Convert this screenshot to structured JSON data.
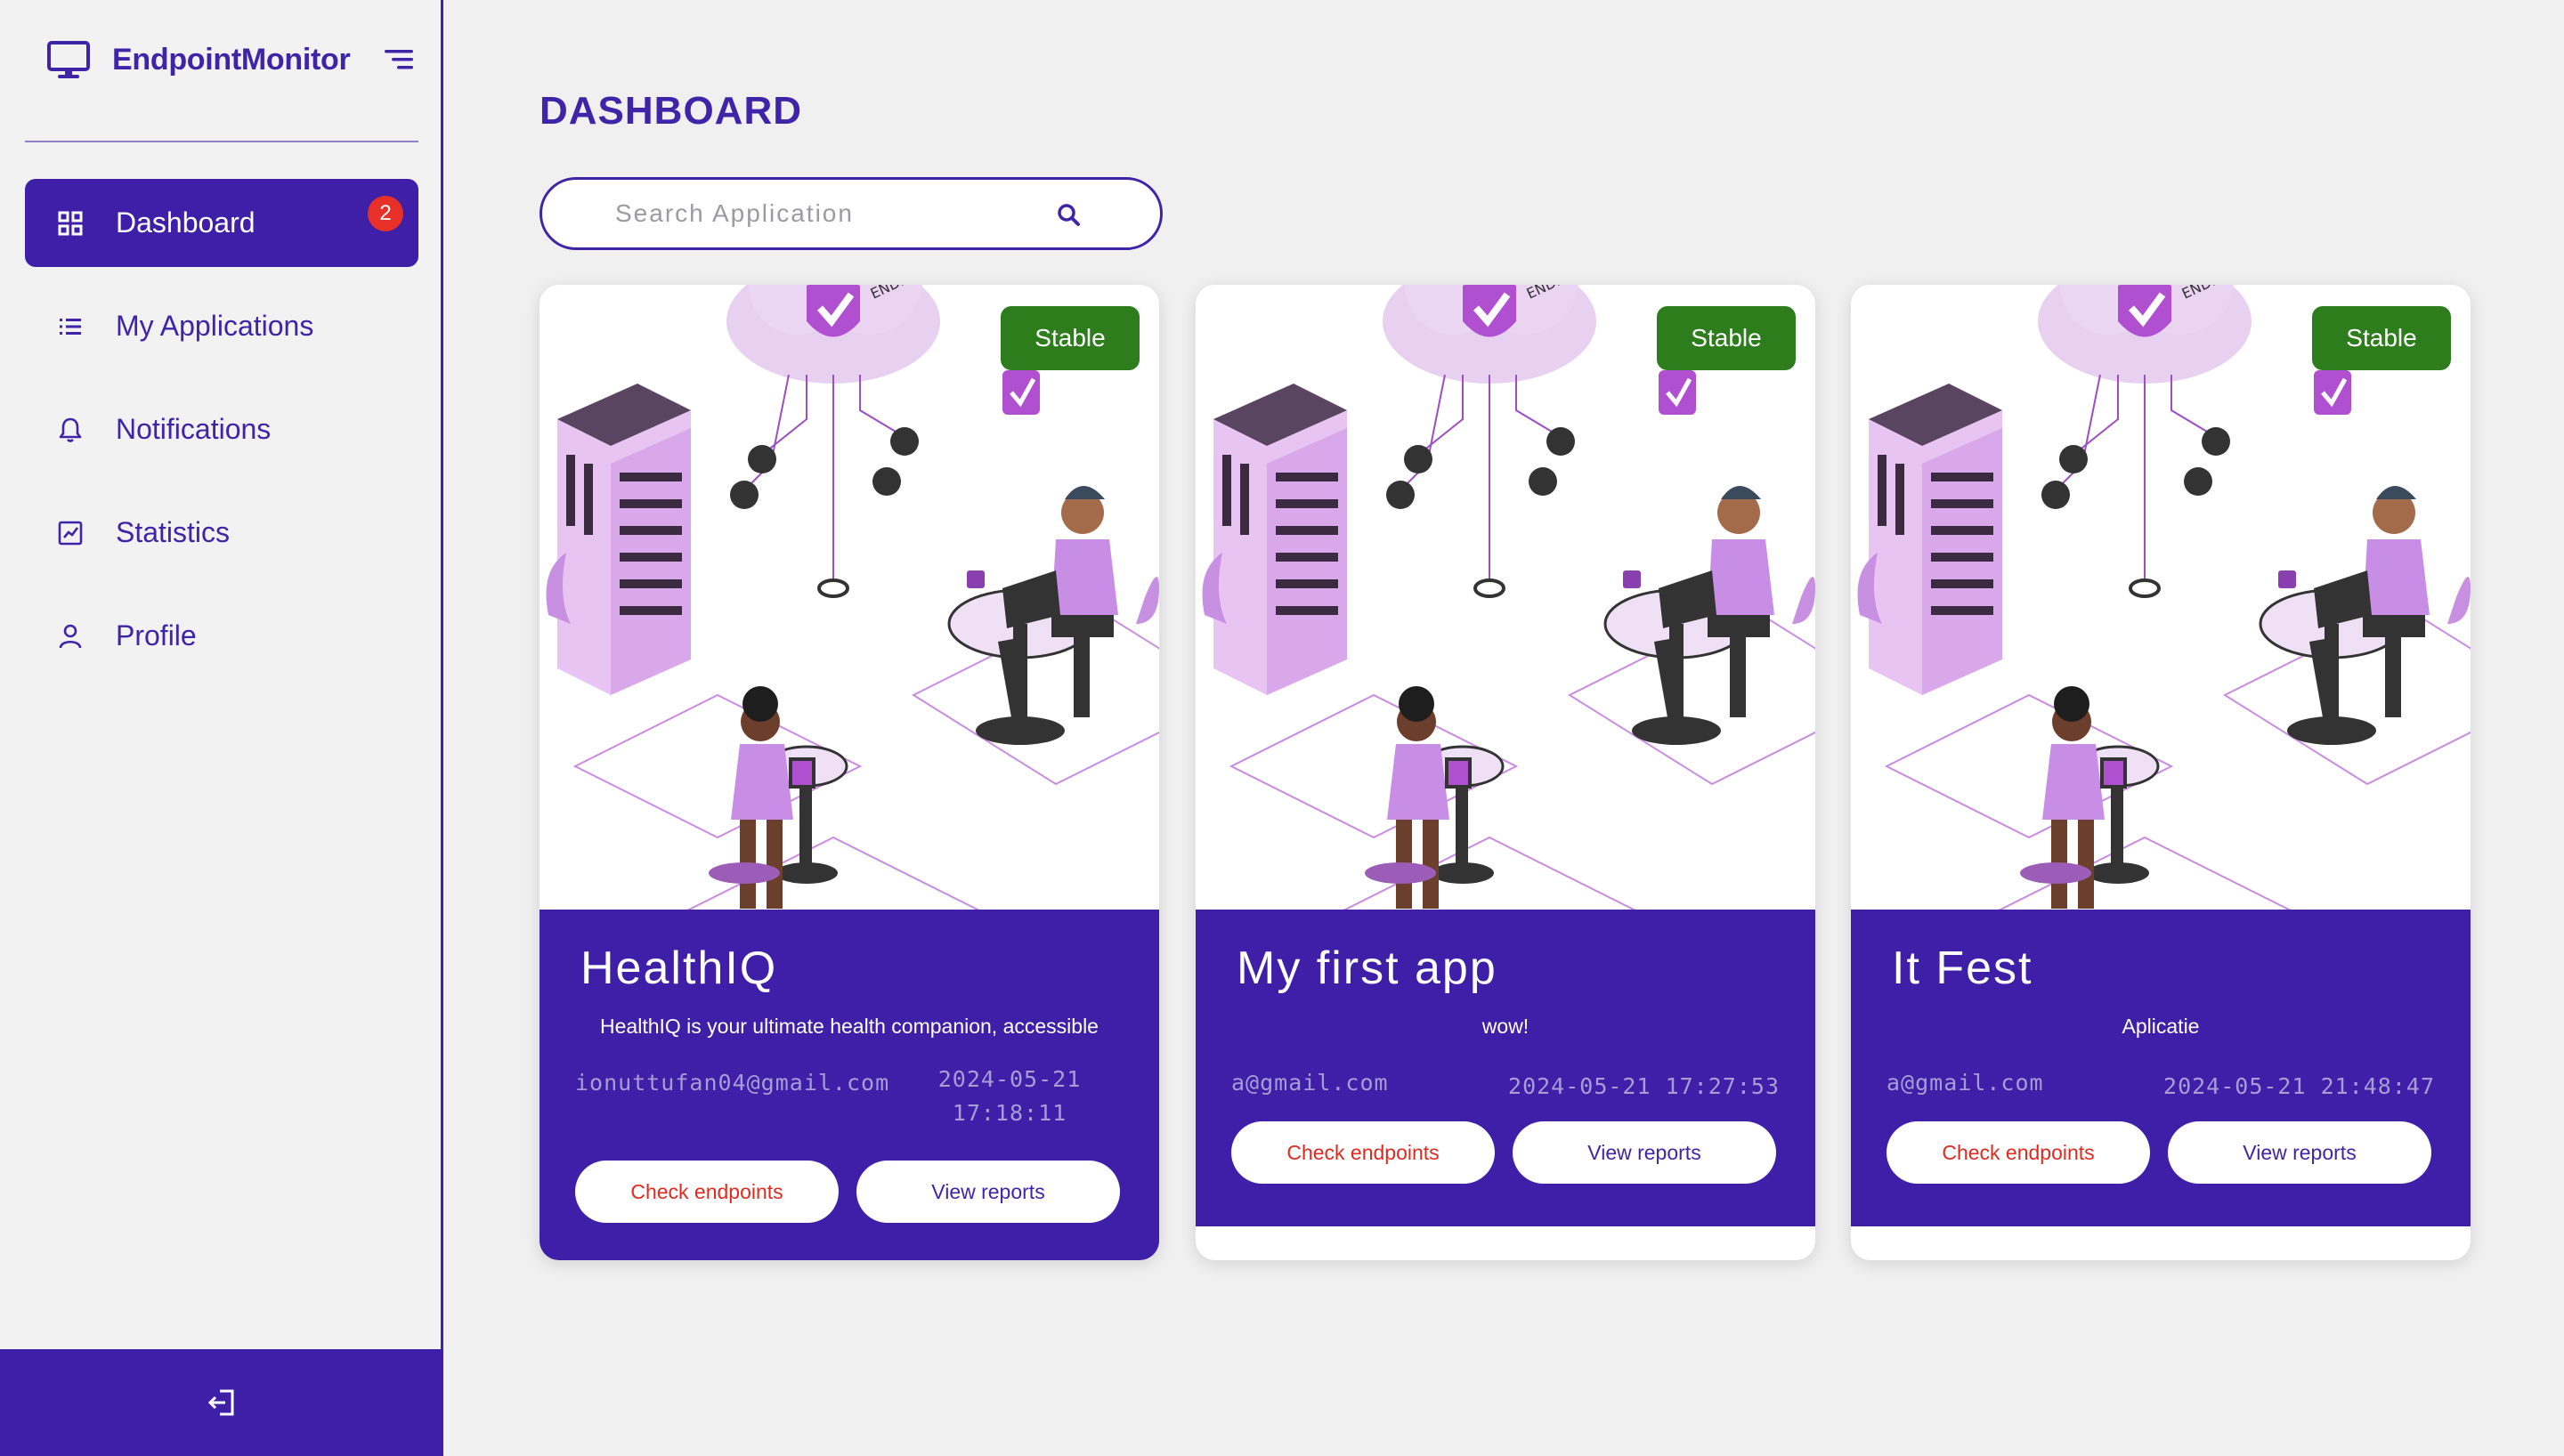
{
  "sidebar": {
    "brand": "EndpointMonitor",
    "brand_icon": "monitor-icon",
    "toggle_icon": "menu-icon",
    "items": [
      {
        "label": "Dashboard",
        "icon": "grid-icon",
        "active": true
      },
      {
        "label": "My Applications",
        "icon": "list-icon",
        "active": false
      },
      {
        "label": "Notifications",
        "icon": "bell-icon",
        "active": false,
        "badge": "2"
      },
      {
        "label": "Statistics",
        "icon": "chart-icon",
        "active": false
      },
      {
        "label": "Profile",
        "icon": "user-icon",
        "active": false
      }
    ],
    "logout_icon": "logout-icon"
  },
  "main": {
    "title": "DASHBOARD",
    "search": {
      "placeholder": "Search Application",
      "value": ""
    },
    "cards": [
      {
        "status": "Stable",
        "name": "HealthIQ",
        "description": "HealthIQ is your ultimate health companion, accessible",
        "email": "ionuttufan04@gmail.com",
        "date": "2024-05-21 17:18:11",
        "check_label": "Check endpoints",
        "view_label": "View reports"
      },
      {
        "status": "Stable",
        "name": "My first app",
        "description": "wow!",
        "email": "a@gmail.com",
        "date": "2024-05-21 17:27:53",
        "check_label": "Check endpoints",
        "view_label": "View reports"
      },
      {
        "status": "Stable",
        "name": "It Fest",
        "description": "Aplicatie",
        "email": "a@gmail.com",
        "date": "2024-05-21 21:48:47",
        "check_label": "Check endpoints",
        "view_label": "View reports"
      }
    ]
  },
  "colors": {
    "primary": "#3f1fa8",
    "badge_red": "#e63028",
    "status_green": "#2e7d1c",
    "background": "#f0f0f1"
  }
}
